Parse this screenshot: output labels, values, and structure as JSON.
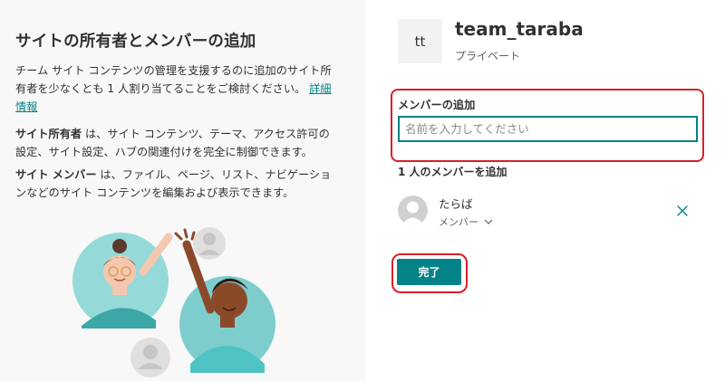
{
  "left": {
    "title": "サイトの所有者とメンバーの追加",
    "intro": "チーム サイト コンテンツの管理を支援するのに追加のサイト所有者を少なくとも 1 人割り当てることをご検討ください。",
    "details_link": "詳細情報",
    "owner_term": "サイト所有者",
    "owner_desc": " は、サイト コンテンツ、テーマ、アクセス許可の設定、サイト設定、ハブの関連付けを完全に制御できます。",
    "member_term": "サイト メンバー",
    "member_desc": " は、ファイル、ページ、リスト、ナビゲーションなどのサイト コンテンツを編集および表示できます。"
  },
  "site": {
    "initials": "tt",
    "name": "team_taraba",
    "privacy": "プライベート"
  },
  "add_members": {
    "label": "メンバーの追加",
    "placeholder": "名前を入力してください",
    "count_label": "1 人のメンバーを追加"
  },
  "members": [
    {
      "name": "たらば",
      "role": "メンバー"
    }
  ],
  "actions": {
    "done_label": "完了"
  },
  "colors": {
    "accent": "#038387",
    "highlight": "#d6202a"
  }
}
